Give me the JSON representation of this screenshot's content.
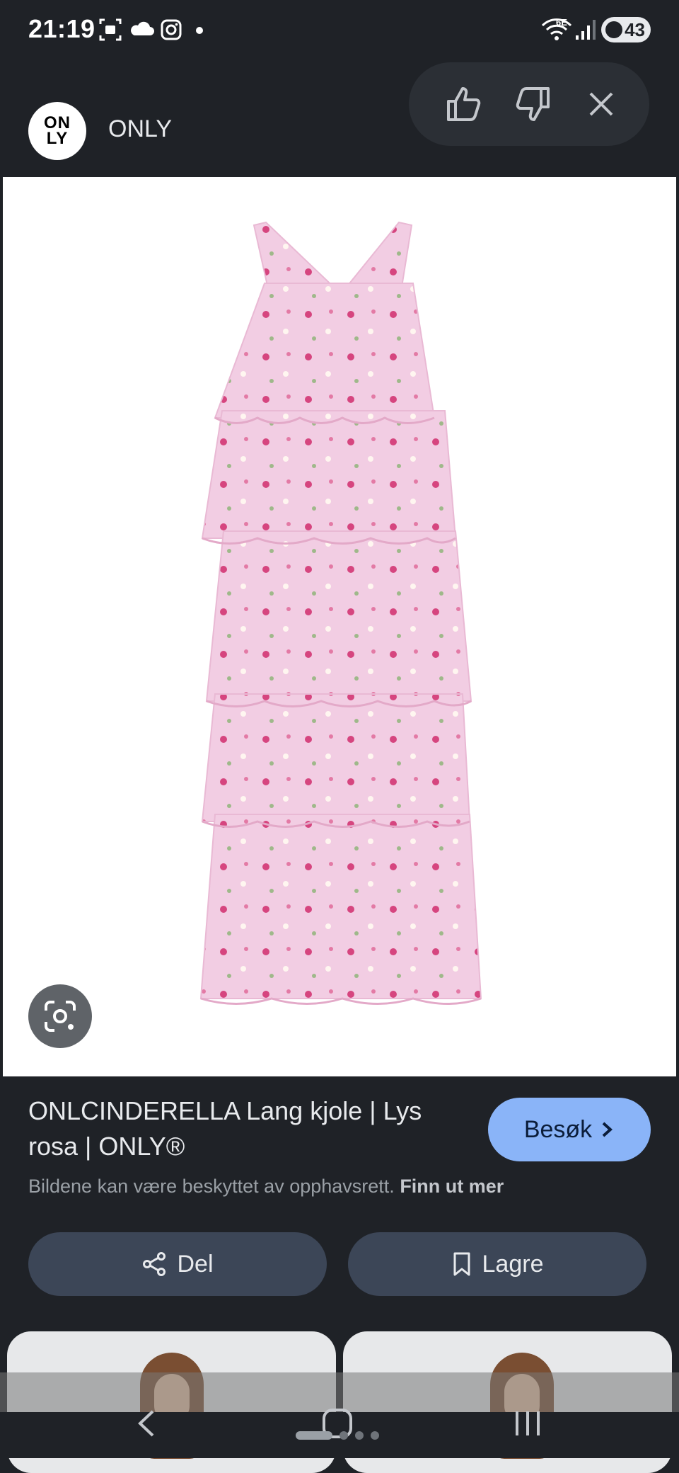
{
  "status_bar": {
    "time": "21:19",
    "battery": "43",
    "network": "6E"
  },
  "header": {
    "logo_text_line1": "ON",
    "logo_text_line2": "LY",
    "brand": "ONLY"
  },
  "feedback": {
    "like_icon": "thumb-up-icon",
    "dislike_icon": "thumb-down-icon",
    "close_icon": "close-icon"
  },
  "product": {
    "title": "ONLCINDERELLA Lang kjole | Lys rosa | ONLY®",
    "visit_label": "Besøk",
    "copyright_text": "Bildene kan være beskyttet av opphavsrett.",
    "learn_more": "Finn ut mer"
  },
  "actions": {
    "share_label": "Del",
    "save_label": "Lagre"
  },
  "colors": {
    "background": "#1f2227",
    "accent": "#8ab4f8",
    "action_button": "#3c4657",
    "dress_pink": "#f0c8e0"
  }
}
